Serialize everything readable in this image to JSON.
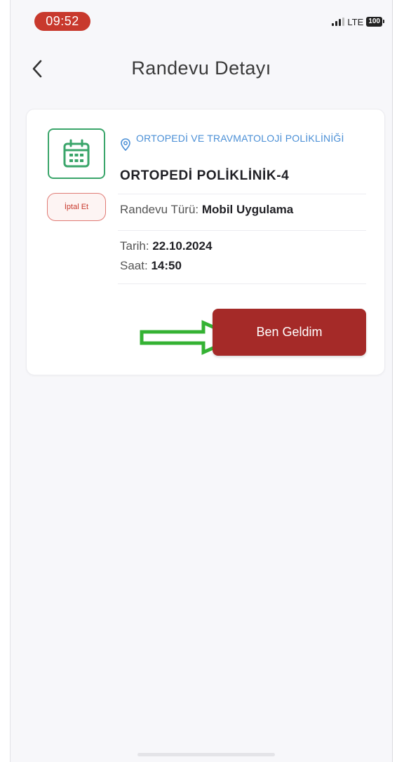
{
  "status_bar": {
    "time": "09:52",
    "network": "LTE",
    "battery": "100"
  },
  "header": {
    "title": "Randevu Detayı"
  },
  "appointment": {
    "clinic": "ORTOPEDİ VE TRAVMATOLOJİ POLİKLİNİĞİ",
    "unit": "ORTOPEDİ POLİKLİNİK-4",
    "type_label": "Randevu Türü:",
    "type_value": "Mobil Uygulama",
    "date_label": "Tarih:",
    "date_value": "22.10.2024",
    "time_label": "Saat:",
    "time_value": "14:50",
    "cancel_label": "İptal Et",
    "checkin_label": "Ben Geldim"
  },
  "colors": {
    "accent_red": "#a52a28",
    "status_red": "#c8392d",
    "calendar_green": "#3aa56a",
    "link_blue": "#4a8fd6",
    "arrow_green": "#34b233"
  },
  "icons": {
    "back": "chevron-left-icon",
    "calendar": "calendar-icon",
    "location": "map-pin-icon",
    "annotation": "right-arrow-icon"
  }
}
